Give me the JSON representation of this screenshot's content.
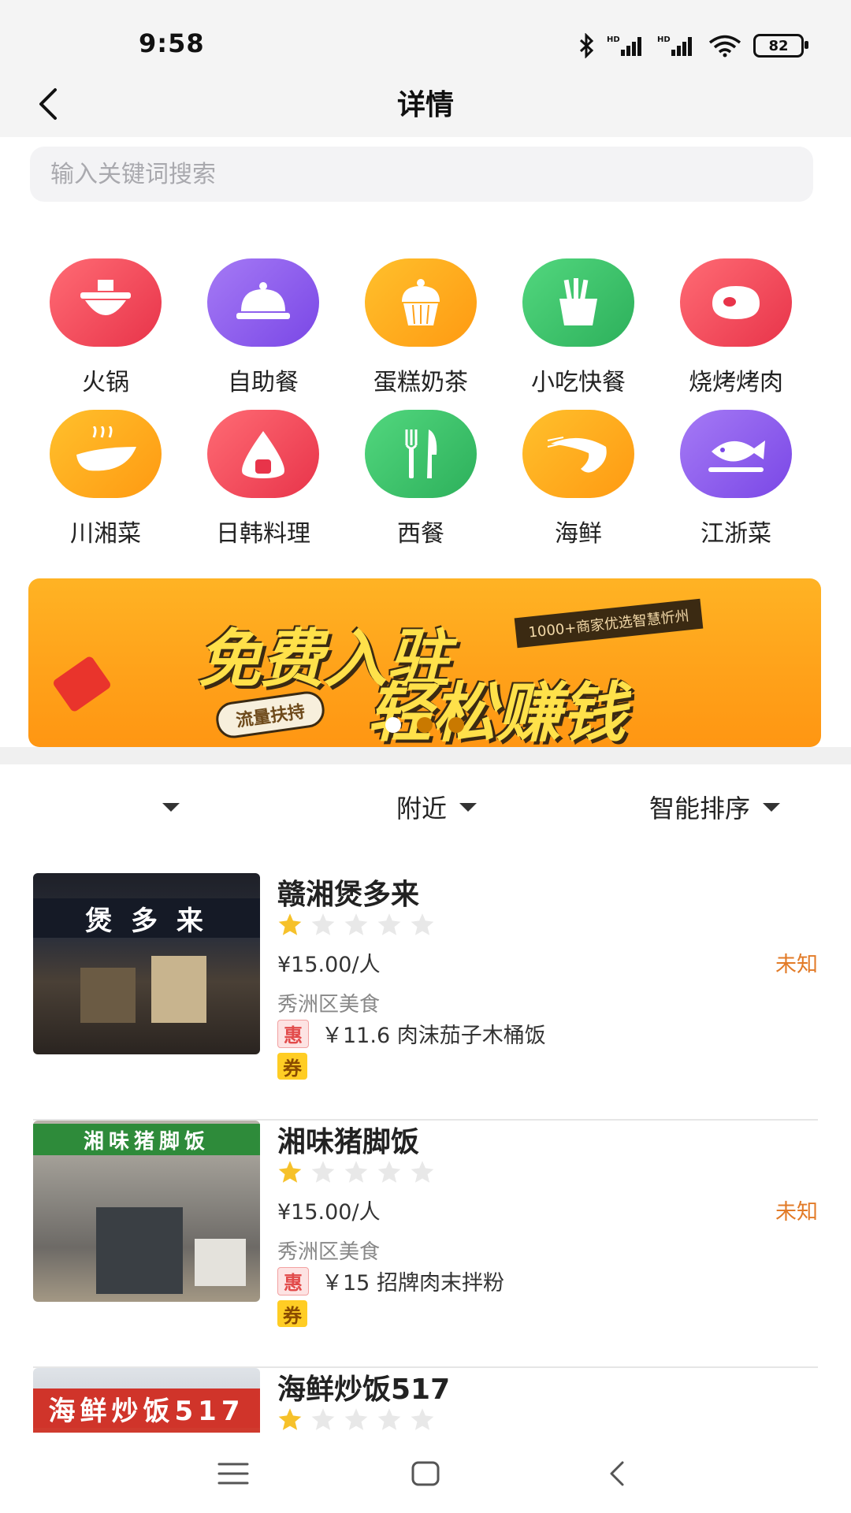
{
  "status_bar": {
    "time": "9:58",
    "battery": "82"
  },
  "nav": {
    "title": "详情"
  },
  "search": {
    "placeholder": "输入关键词搜索"
  },
  "categories": [
    {
      "label": "火锅",
      "icon": "hotpot-icon",
      "color": "#f04a55"
    },
    {
      "label": "自助餐",
      "icon": "cloche-icon",
      "color": "#8d5cf0"
    },
    {
      "label": "蛋糕奶茶",
      "icon": "cupcake-icon",
      "color": "#ffa21a"
    },
    {
      "label": "小吃快餐",
      "icon": "fries-icon",
      "color": "#3dc26a"
    },
    {
      "label": "烧烤烤肉",
      "icon": "steak-icon",
      "color": "#f04a55"
    },
    {
      "label": "川湘菜",
      "icon": "chili-icon",
      "color": "#ffa21a"
    },
    {
      "label": "日韩料理",
      "icon": "onigiri-icon",
      "color": "#f04a55"
    },
    {
      "label": "西餐",
      "icon": "fork-knife-icon",
      "color": "#3dc26a"
    },
    {
      "label": "海鲜",
      "icon": "shrimp-icon",
      "color": "#ffa21a"
    },
    {
      "label": "江浙菜",
      "icon": "fish-icon",
      "color": "#8d5cf0"
    }
  ],
  "banner": {
    "line1": "免费入驻",
    "line2": "轻松赚钱",
    "tag": "1000+商家优选智慧忻州",
    "pill": "流量扶持",
    "slides": 3,
    "active_slide": 0
  },
  "filters": {
    "first": "",
    "nearby": "附近",
    "sort": "智能排序"
  },
  "shops": [
    {
      "name": "赣湘煲多来",
      "rating": 1,
      "price": "¥15.00/人",
      "status": "未知",
      "district": "秀洲区美食",
      "deal": "￥11.6 肉沫茄子木桶饭",
      "badge_hui": "惠",
      "badge_quan": "券",
      "sign": "煲 多 来",
      "sign_color": "#ffffff"
    },
    {
      "name": "湘味猪脚饭",
      "rating": 1,
      "price": "¥15.00/人",
      "status": "未知",
      "district": "秀洲区美食",
      "deal": "￥15 招牌肉末拌粉",
      "badge_hui": "惠",
      "badge_quan": "券",
      "sign": "湘味猪脚饭",
      "sign_color": "#ffffff"
    },
    {
      "name": "海鲜炒饭517",
      "rating": 1,
      "sign": "海鲜炒饭517",
      "sign_color": "#ffffff"
    }
  ]
}
